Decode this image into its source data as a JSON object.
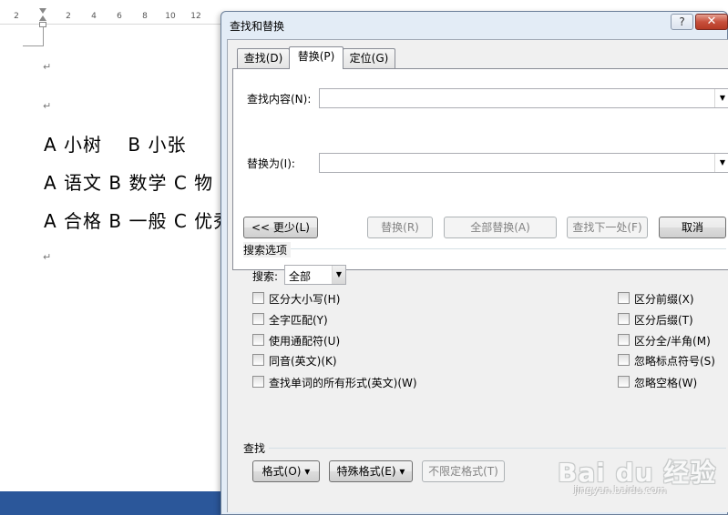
{
  "document": {
    "ruler_ticks": [
      "2",
      "2",
      "4",
      "6",
      "8",
      "10",
      "12"
    ],
    "paragraph_mark": "↵",
    "lines": [
      "A 小树　 B 小张",
      "A 语文  B 数学  C 物",
      "A 合格 B 一般 C 优秀"
    ]
  },
  "dialog": {
    "title": "查找和替换",
    "help_label": "?",
    "close_label": "✕",
    "tabs": [
      {
        "label": "查找(D)",
        "active": false
      },
      {
        "label": "替换(P)",
        "active": true
      },
      {
        "label": "定位(G)",
        "active": false
      }
    ],
    "find_what": {
      "label": "查找内容(N):",
      "value": ""
    },
    "replace_with": {
      "label": "替换为(I):",
      "value": ""
    },
    "buttons": {
      "less": "<< 更少(L)",
      "replace": "替换(R)",
      "replace_all": "全部替换(A)",
      "find_next": "查找下一处(F)",
      "cancel": "取消"
    },
    "search_options": {
      "title": "搜索选项",
      "search_label": "搜索:",
      "search_value": "全部",
      "left_options": [
        {
          "label": "区分大小写(H)",
          "checked": false
        },
        {
          "label": "全字匹配(Y)",
          "checked": false
        },
        {
          "label": "使用通配符(U)",
          "checked": false
        },
        {
          "label": "同音(英文)(K)",
          "checked": false
        },
        {
          "label": "查找单词的所有形式(英文)(W)",
          "checked": false
        }
      ],
      "right_options": [
        {
          "label": "区分前缀(X)",
          "checked": false
        },
        {
          "label": "区分后缀(T)",
          "checked": false
        },
        {
          "label": "区分全/半角(M)",
          "checked": false
        },
        {
          "label": "忽略标点符号(S)",
          "checked": false
        },
        {
          "label": "忽略空格(W)",
          "checked": false
        }
      ]
    },
    "find_group": {
      "title": "查找",
      "format_button": "格式(O) ▾",
      "special_button": "特殊格式(E) ▾",
      "no_formatting_button": "不限定格式(T)"
    }
  },
  "watermark": {
    "logo": "Bai du 经验",
    "url": "jingyan.baidu.com"
  }
}
